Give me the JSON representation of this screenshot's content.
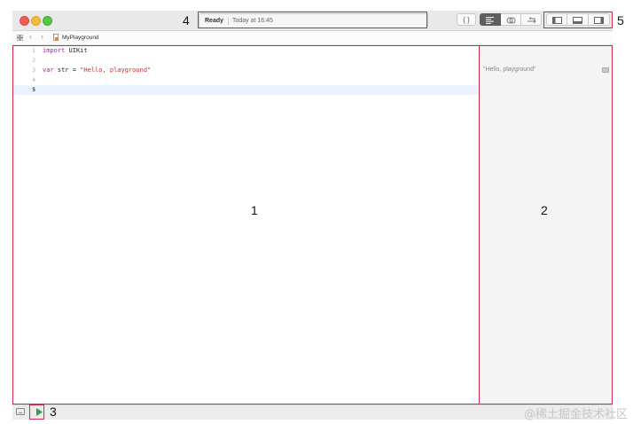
{
  "window": {
    "status_ready": "Ready",
    "status_time": "Today at 16:45",
    "toolbar_buttons": [
      "{ }",
      "≡",
      "⊘",
      "⇄"
    ],
    "layout_buttons": [
      "left-panel",
      "bottom-panel",
      "right-panel"
    ]
  },
  "pathbar": {
    "file_name": "MyPlayground"
  },
  "editor": {
    "lines": [
      {
        "number": "1",
        "keyword": "import",
        "rest": " UIKit",
        "string": ""
      },
      {
        "number": "2",
        "keyword": "",
        "rest": "",
        "string": ""
      },
      {
        "number": "3",
        "keyword": "var",
        "rest": " str = ",
        "string": "\"Hello, playground\""
      },
      {
        "number": "4",
        "keyword": "",
        "rest": "",
        "string": ""
      },
      {
        "number": "5",
        "keyword": "",
        "rest": "",
        "string": ""
      }
    ]
  },
  "results": {
    "value": "\"Hello, playground\""
  },
  "annotations": {
    "labels": [
      "1",
      "2",
      "3",
      "4",
      "5"
    ]
  },
  "watermark": "@稀土掘金技术社区",
  "colors": {
    "annotation_red": "#d3284b",
    "keyword_purple": "#b31fa0",
    "string_red": "#c4312a",
    "current_line": "#ecf4ff",
    "run_green": "#2f9e4f"
  }
}
